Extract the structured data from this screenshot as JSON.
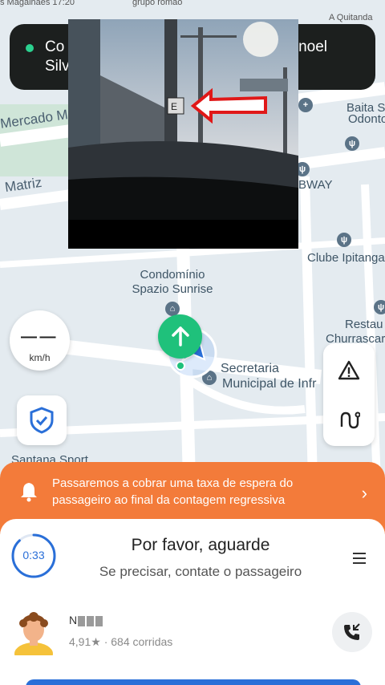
{
  "status_bar": {
    "left_text": "s Magalhães 17:20",
    "center_text": "grupo romão",
    "right_text": "A Quitanda"
  },
  "navigation": {
    "line1_left": "Co",
    "line1_right": "noel",
    "line2": "Silv"
  },
  "map": {
    "labels": {
      "mercado": "Mercado M",
      "matriz": "Matriz",
      "baita_line1": "Baita S",
      "baita_line2": "Odonto",
      "bway": "BWAY",
      "clube": "Clube Ipitanga",
      "condominio_line1": "Condomínio",
      "condominio_line2": "Spazio Sunrise",
      "restaurante_line1": "Restau",
      "restaurante_line2": "Churrascar",
      "secretaria_line1": "Secretaria",
      "secretaria_line2": "Municipal de Infr",
      "santana": "Santana Sport"
    }
  },
  "speedometer": {
    "value": "— —",
    "unit": "km/h"
  },
  "notice": {
    "text": "Passaremos a cobrar uma taxa de espera do passageiro ao final da contagem regressiva",
    "chevron": "›"
  },
  "sheet": {
    "timer": "0:33",
    "timer_progress": 0.88,
    "title": "Por favor, aguarde",
    "subtitle": "Se precisar, contate o passageiro"
  },
  "passenger": {
    "name_initial": "N",
    "rating": "4,91★ · 684 corridas"
  },
  "colors": {
    "accent_blue": "#2a6fd8",
    "notice_orange": "#f37b3a",
    "go_green": "#1fc17b",
    "banner_dark": "#1c1f1e"
  }
}
